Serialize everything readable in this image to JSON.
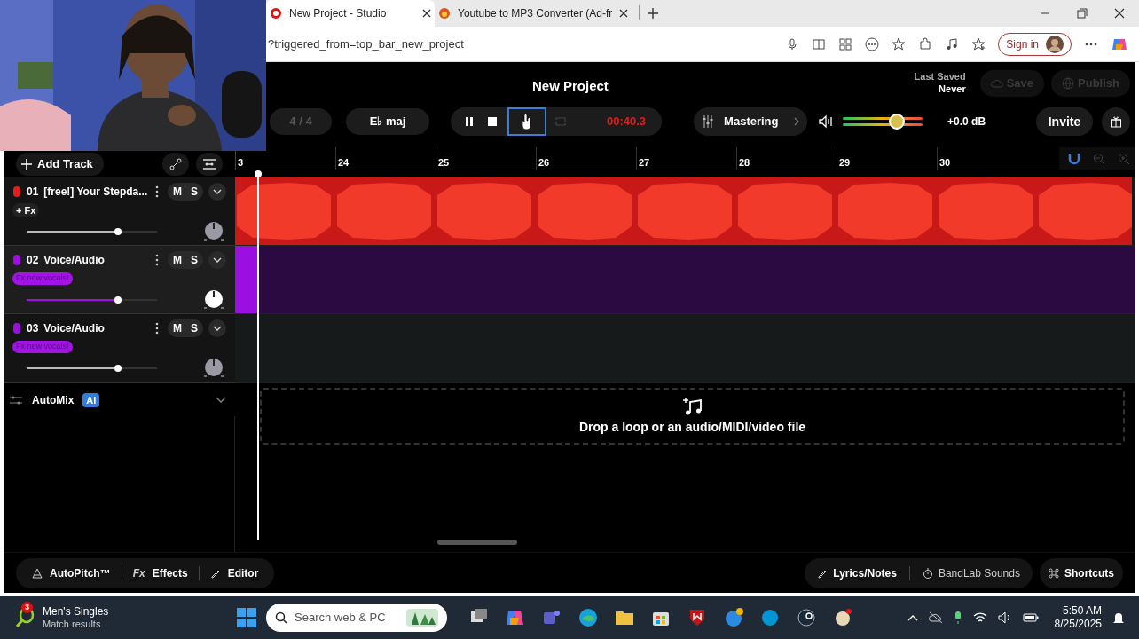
{
  "browser": {
    "tabs": [
      {
        "title": "New Project - Studio",
        "selected": true
      },
      {
        "title": "Youtube to MP3 Converter (Ad-fr",
        "selected": false
      }
    ],
    "url": "?triggered_from=top_bar_new_project",
    "sign_in": "Sign in"
  },
  "header": {
    "title": "New Project",
    "last_saved_label": "Last Saved",
    "last_saved_value": "Never",
    "actions": [
      {
        "label": "Save",
        "disabled": true
      },
      {
        "label": "Publish",
        "disabled": true
      }
    ]
  },
  "toolbar": {
    "time_signature": {
      "label": "4 / 4",
      "disabled": true
    },
    "key": "E♭ maj",
    "time": "00:40.3",
    "mastering": "Mastering",
    "master_volume": {
      "level": 0.68
    },
    "gain": "+0.0 dB",
    "invite": "Invite"
  },
  "ruler": [
    "3",
    "24",
    "25",
    "26",
    "27",
    "28",
    "29",
    "30"
  ],
  "sidebar": {
    "add_track": "Add Track"
  },
  "tracks": [
    {
      "number": "01",
      "name": "[free!] Your Stepda...",
      "color": "#e0201f",
      "selected": false,
      "fx": {
        "kind": "add",
        "label": "+ Fx"
      },
      "mute": "M",
      "solo": "S",
      "volume": {
        "level": 0.7
      },
      "clip": {
        "kind": "waveform"
      }
    },
    {
      "number": "02",
      "name": "Voice/Audio",
      "color": "#9b10e0",
      "selected": true,
      "fx": {
        "kind": "preset",
        "label": "Fx new vocals!"
      },
      "mute": "M",
      "solo": "S",
      "volume": {
        "level": 0.7
      },
      "clip": {
        "kind": "block"
      }
    },
    {
      "number": "03",
      "name": "Voice/Audio",
      "color": "#9b10e0",
      "selected": false,
      "fx": {
        "kind": "preset",
        "label": "Fx new vocals!"
      },
      "mute": "M",
      "solo": "S",
      "volume": {
        "level": 0.7
      }
    }
  ],
  "automix": {
    "label": "AutoMix",
    "badge": "AI",
    "expanded": false
  },
  "drop_zone": {
    "text": "Drop a loop or an audio/MIDI/video file"
  },
  "bottom_bar": {
    "left": [
      {
        "label": "AutoPitch™"
      },
      {
        "prefix": "Fx",
        "label": "Effects"
      },
      {
        "label": "Editor"
      }
    ],
    "right": [
      {
        "label": "Lyrics/Notes"
      },
      {
        "label": "BandLab Sounds"
      },
      {
        "label": "Shortcuts"
      }
    ]
  },
  "taskbar": {
    "widget_title": "Men's Singles",
    "widget_subtitle": "Match results",
    "widget_badge": "3",
    "search_placeholder": "Search web & PC",
    "time": "5:50 AM",
    "date": "8/25/2025"
  }
}
